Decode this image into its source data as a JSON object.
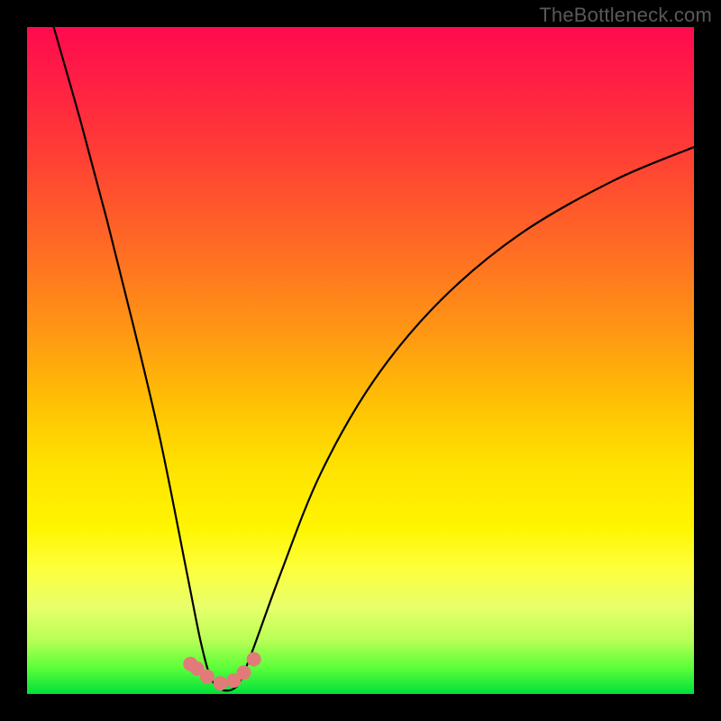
{
  "watermark": "TheBottleneck.com",
  "chart_data": {
    "type": "line",
    "title": "",
    "xlabel": "",
    "ylabel": "",
    "xlim": [
      0,
      100
    ],
    "ylim": [
      0,
      100
    ],
    "grid": false,
    "legend": false,
    "series": [
      {
        "name": "bottleneck-curve",
        "x": [
          4,
          8,
          12,
          16,
          20,
          24,
          26,
          27.5,
          29,
          30,
          31,
          32,
          34,
          38,
          44,
          52,
          62,
          74,
          88,
          100
        ],
        "y": [
          100,
          86,
          71,
          55,
          38,
          18,
          8,
          2.5,
          0.8,
          0.5,
          0.8,
          2,
          7,
          18,
          33,
          47,
          59,
          69,
          77,
          82
        ]
      },
      {
        "name": "bottom-dots",
        "x": [
          24.5,
          25.5,
          27,
          29,
          31,
          32.5,
          34
        ],
        "y": [
          4.5,
          3.8,
          2.6,
          1.6,
          2.0,
          3.2,
          5.2
        ]
      }
    ],
    "colors": {
      "curve": "#000000",
      "dots": "#e27a7a"
    }
  }
}
